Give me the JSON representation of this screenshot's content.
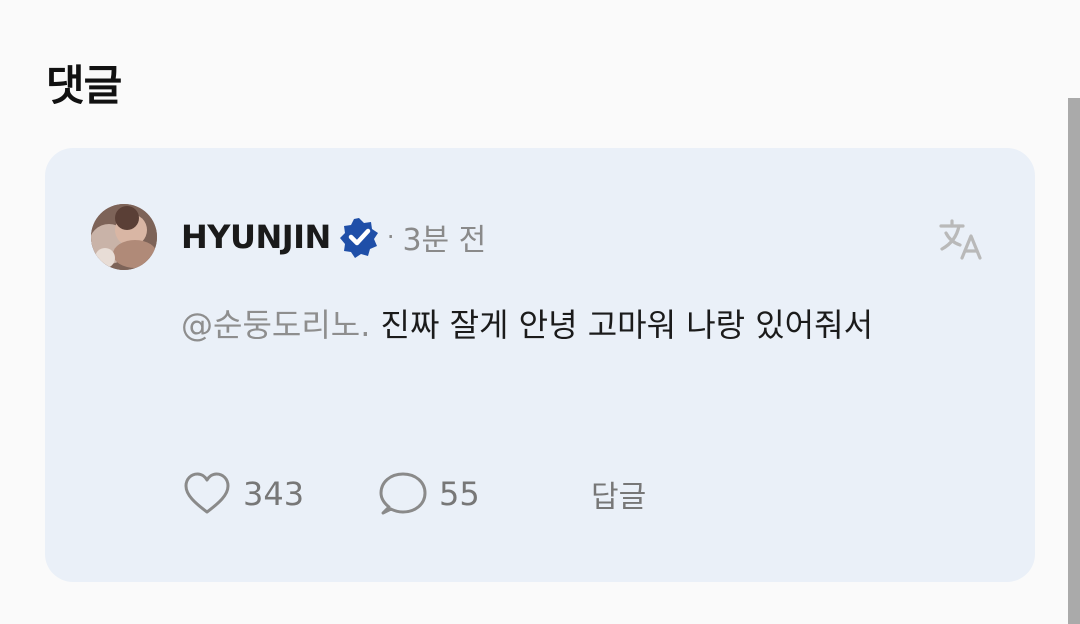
{
  "section": {
    "title": "댓글"
  },
  "comment": {
    "author": "HYUNJIN",
    "separator": "·",
    "time": "3분 전",
    "mention": "@순둥도리노.",
    "text": " 진짜 잘게 안녕 고마워 나랑 있어줘서",
    "likes": "343",
    "replies": "55",
    "reply_label": "답글"
  },
  "colors": {
    "card_background": "#eaf0f8",
    "verified_badge": "#1f4fa8",
    "mention": "#8e8e8e",
    "muted": "#777777"
  },
  "icons": [
    "verified-badge-icon",
    "translate-icon",
    "heart-icon",
    "speech-bubble-icon"
  ]
}
